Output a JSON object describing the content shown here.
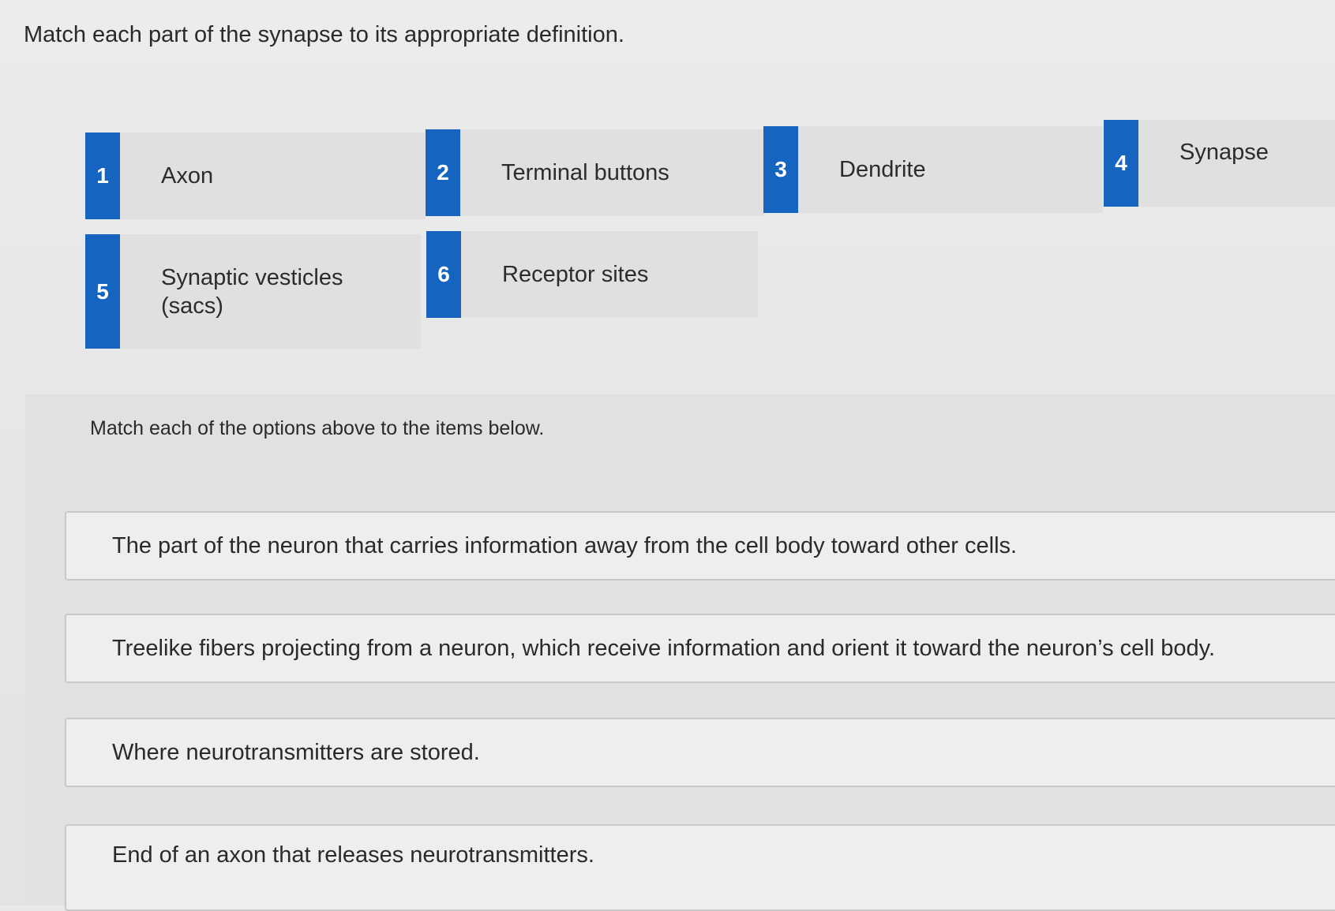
{
  "question": {
    "prompt": "Match each part of the synapse to its appropriate definition."
  },
  "options": [
    {
      "number": "1",
      "label": "Axon"
    },
    {
      "number": "2",
      "label": "Terminal buttons"
    },
    {
      "number": "3",
      "label": "Dendrite"
    },
    {
      "number": "4",
      "label": "Synapse"
    },
    {
      "number": "5",
      "label": "Synaptic vesticles (sacs)"
    },
    {
      "number": "6",
      "label": "Receptor sites"
    }
  ],
  "matching": {
    "instruction": "Match each of the options above to the items below.",
    "items": [
      {
        "text": "The part of the neuron that carries information away from the cell body toward other cells."
      },
      {
        "text": "Treelike fibers projecting from a neuron, which receive information and orient it toward the neuron’s cell body."
      },
      {
        "text": "Where neurotransmitters are stored."
      },
      {
        "text": "End of an axon that releases neurotransmitters."
      }
    ]
  },
  "colors": {
    "badge": "#1565c0",
    "option_bg": "#e0e0e0",
    "drop_zone_bg": "#eeeeee",
    "page_bg": "#e9e9e9"
  }
}
